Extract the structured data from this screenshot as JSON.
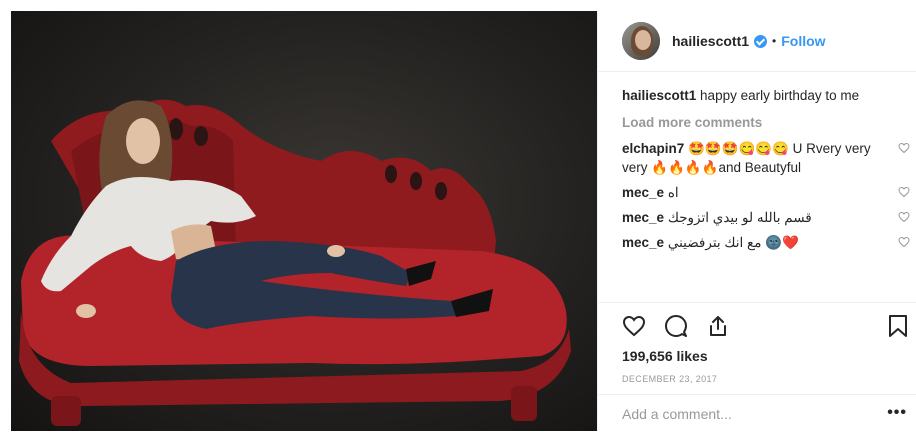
{
  "post": {
    "username": "hailiescott1",
    "follow_label": "Follow",
    "separator": "•",
    "caption": {
      "user": "hailiescott1",
      "text": "happy early birthday to me"
    },
    "load_more": "Load more comments",
    "comments": [
      {
        "user": "elchapin7",
        "text": "🤩🤩🤩😋😋😋 U Rvery very very 🔥🔥🔥🔥and Beautyful"
      },
      {
        "user": "mec_e",
        "text": "اه"
      },
      {
        "user": "mec_e",
        "text": "قسم بالله لو بيدي اتزوجك"
      },
      {
        "user": "mec_e",
        "text": "مع انك بترفضيني 🌚❤️"
      }
    ],
    "likes": "199,656 likes",
    "date": "DECEMBER 23, 2017",
    "add_comment_placeholder": "Add a comment...",
    "more_options": "•••"
  },
  "colors": {
    "accent": "#3897f0",
    "text": "#262626",
    "muted": "#999999",
    "border": "#efefef",
    "sofa": "#a81f24"
  },
  "icons": [
    "verified-badge-icon",
    "heart-icon",
    "comment-icon",
    "share-icon",
    "bookmark-icon",
    "comment-like-icon"
  ]
}
